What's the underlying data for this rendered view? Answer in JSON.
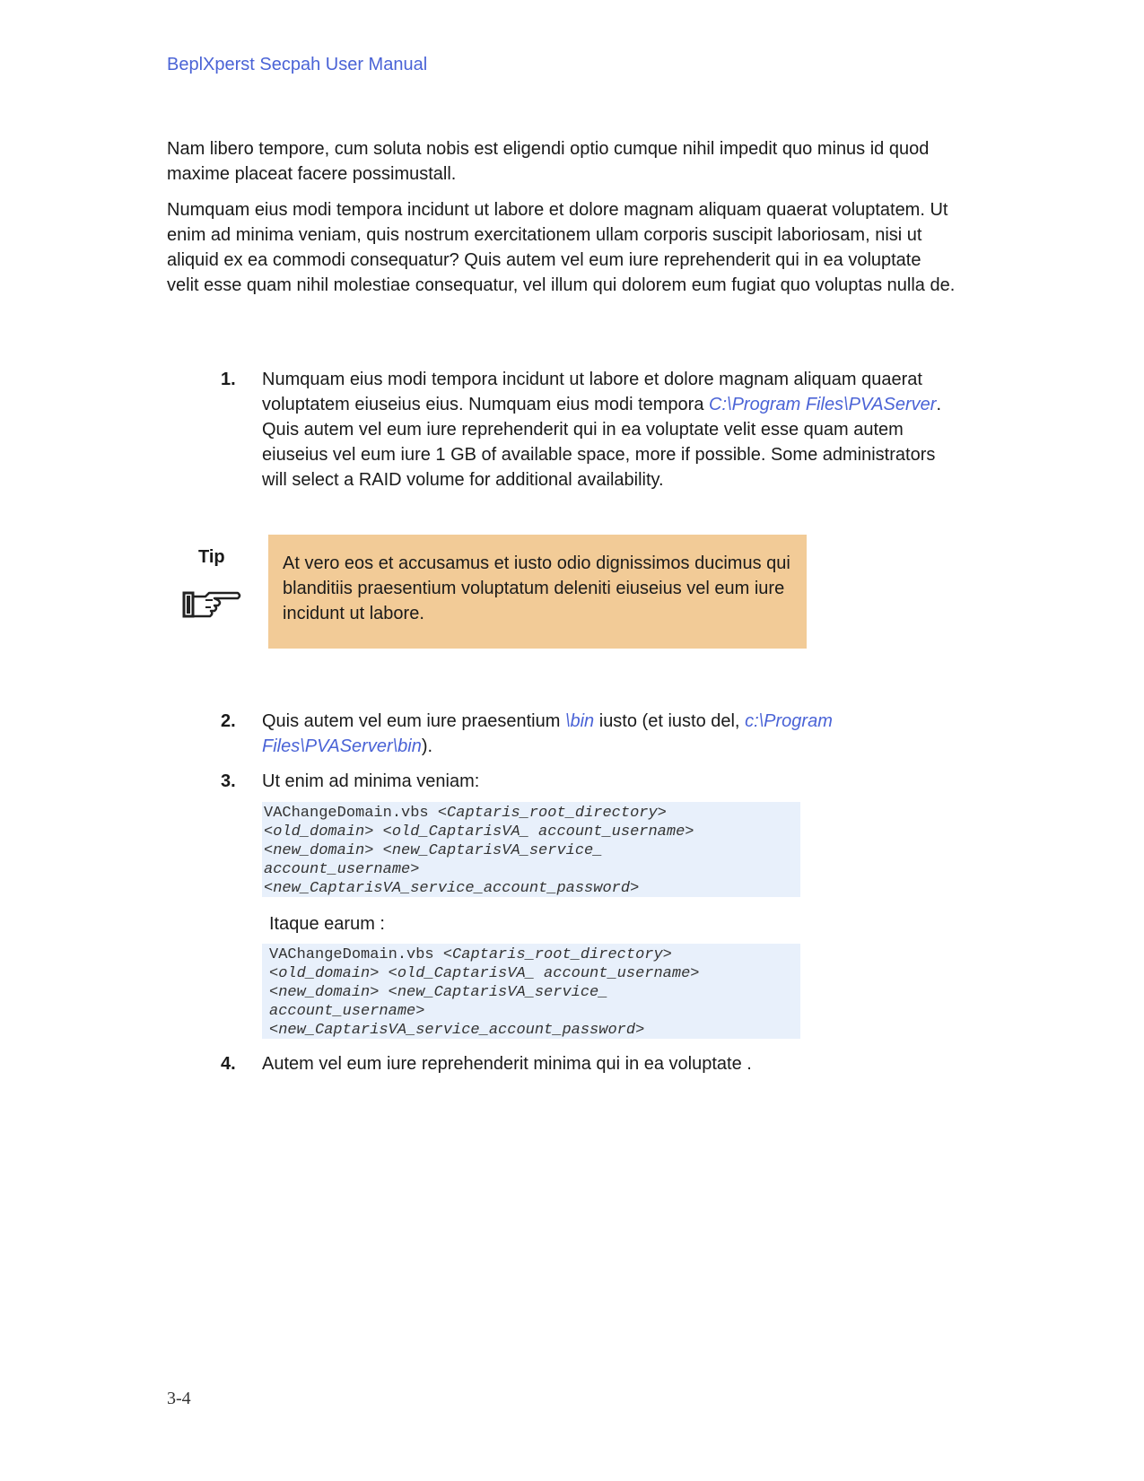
{
  "header": {
    "title": "BeplXperst Secpah User Manual"
  },
  "paragraphs": [
    "Nam libero tempore, cum soluta nobis est eligendi optio cumque nihil impedit quo minus id quod maxime placeat facere possimustall.",
    "Numquam eius modi tempora incidunt ut labore et dolore magnam aliquam quaerat voluptatem. Ut enim ad minima veniam, quis nostrum exercitationem ullam corporis suscipit laboriosam, nisi ut aliquid ex ea commodi consequatur? Quis autem vel eum iure reprehenderit qui in ea voluptate velit esse quam nihil molestiae consequatur, vel illum qui dolorem eum fugiat quo voluptas nulla de."
  ],
  "steps": [
    {
      "number": "1.",
      "text_a": "Numquam eius modi tempora incidunt ut labore et dolore magnam aliquam quaerat voluptatem eiuseius eius. Numquam eius modi tempora ",
      "path_a": "C:\\Program Files\\PVAServer",
      "text_b": ". Quis autem vel eum iure reprehenderit qui in ea voluptate velit esse quam autem eiuseius vel eum iure 1 GB of available space, more if possible. Some administrators will select a RAID volume for additional availability."
    },
    {
      "number": "2.",
      "text_a": "Quis autem vel eum iure praesentium ",
      "path_a": "\\bin",
      "text_b": " iusto (et iusto del, ",
      "path_b": "c:\\Program Files\\PVAServer\\bin",
      "text_c": ")."
    },
    {
      "number": "3.",
      "text": "Ut enim ad minima veniam:"
    },
    {
      "number": "4.",
      "text": "Autem vel eum iure reprehenderit minima qui in ea voluptate ."
    }
  ],
  "tip": {
    "label": "Tip",
    "icon": "pointing-hand-icon",
    "text": "At vero eos et accusamus et iusto odio dignissimos ducimus qui blanditiis praesentium voluptatum deleniti eiuseius vel eum iure incidunt ut labore."
  },
  "code_block_1": {
    "command": "VAChangeDomain.vbs ",
    "line1_arg": "<Captaris_root_directory>",
    "line2": "<old_domain> <old_CaptarisVA_ account_username>",
    "line3": "<new_domain> <new_CaptarisVA_service_",
    "line4": "account_username>",
    "line5": "<new_CaptarisVA_service_account_password>"
  },
  "itaque_text": "Itaque earum :",
  "code_block_2": {
    "command": "VAChangeDomain.vbs ",
    "line1_arg": "<Captaris_root_directory>",
    "line2": "<old_domain> <old_CaptarisVA_ account_username>",
    "line3": "<new_domain> <new_CaptarisVA_service_",
    "line4": "account_username>",
    "line5": "<new_CaptarisVA_service_account_password>"
  },
  "footer": {
    "page_number": "3-4"
  },
  "colors": {
    "link": "#4a63d6",
    "tip_background": "#f2cb97",
    "code_background": "#e8f0fb"
  }
}
